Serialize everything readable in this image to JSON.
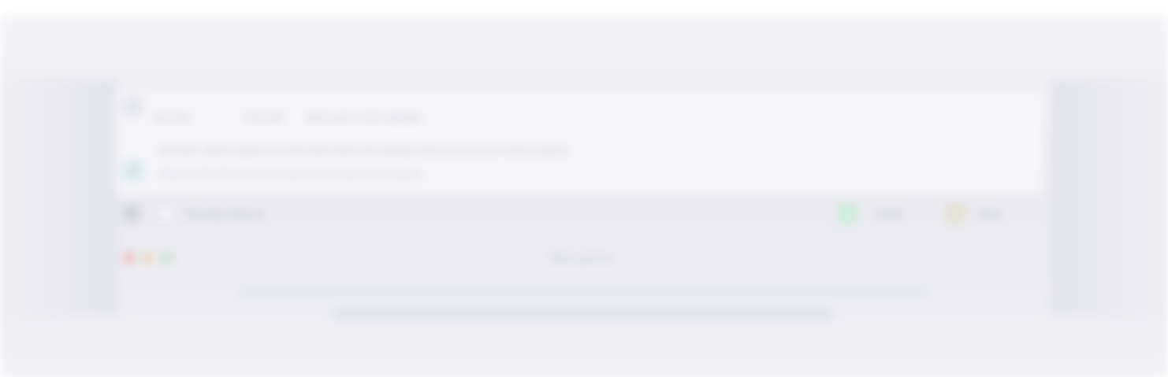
{
  "window": {
    "title": "Slack | general",
    "colors": {
      "close": "#f5a6a6",
      "minimize": "#f3d3a0",
      "zoom": "#b9e3c4",
      "background": "#efeff4",
      "card": "#f5f5f9"
    }
  },
  "messages": {
    "items": [
      {
        "author": "Ana Ruiz",
        "time": "10:02 AM",
        "text": "Quick sync on the roadmap"
      },
      {
        "author": "",
        "time": "",
        "text": "Reminder: please update the sprint board before the standup tomorrow so we can review progress"
      },
      {
        "author": "",
        "time": "",
        "text": "Shared a file with the team and pinned the notes to the channel"
      }
    ]
  },
  "composer": {
    "placeholder": "Message #general",
    "left_icon": "plus-icon",
    "avatar_icon": "user-avatar-icon",
    "actions": [
      {
        "label": "Huddle",
        "icon": "headphones-icon",
        "color": "#cfeedd"
      },
      {
        "label": "Share",
        "icon": "share-icon",
        "color": "#e6e3d6"
      }
    ]
  }
}
